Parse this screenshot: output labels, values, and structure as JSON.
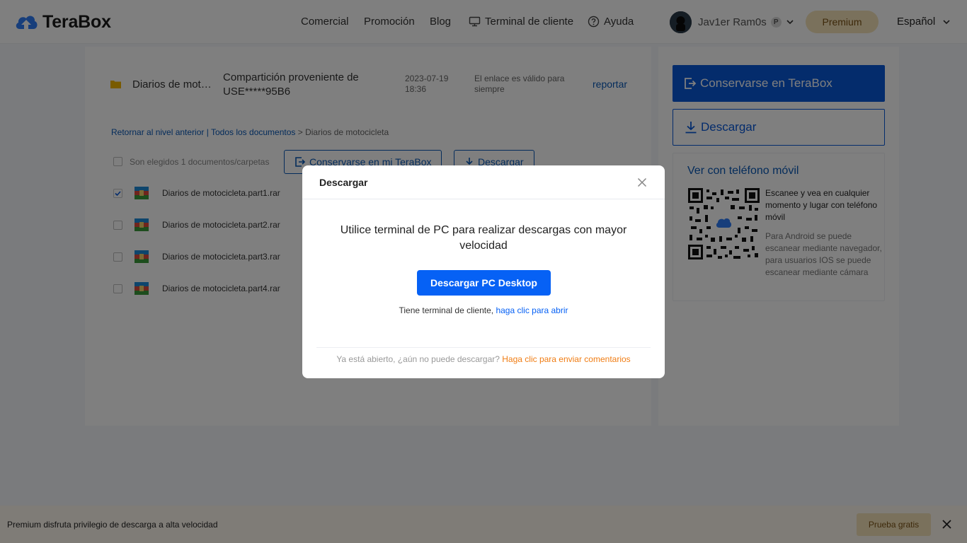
{
  "header": {
    "logo_text": "TeraBox",
    "nav": [
      {
        "label": "Comercial"
      },
      {
        "label": "Promoción"
      },
      {
        "label": "Blog"
      },
      {
        "label": "Terminal de cliente",
        "icon": "monitor-icon"
      },
      {
        "label": "Ayuda",
        "icon": "help-icon"
      }
    ],
    "username": "Jav1er Ram0s",
    "badge": "P",
    "premium_label": "Premium",
    "language": "Español"
  },
  "share": {
    "folder_name": "Diarios de moto...",
    "from_text": "Compartición proveniente de USE*****95B6",
    "date_line1": "2023-07-19",
    "date_line2": "18:36",
    "validity": "El enlace es válido para siempre",
    "report_label": "reportar"
  },
  "breadcrumb": {
    "back": "Retornar al nivel anterior",
    "sep": " | ",
    "all": "Todos los documentos",
    "arrow": " > ",
    "current": "Diarios de motocicleta"
  },
  "toolbar": {
    "selected_text": "Son elegidos 1 documentos/carpetas",
    "keep_label": "Conservarse en mi TeraBox",
    "download_label": "Descargar"
  },
  "files": [
    {
      "name": "Diarios de motocicleta.part1.rar",
      "checked": true
    },
    {
      "name": "Diarios de motocicleta.part2.rar",
      "checked": false
    },
    {
      "name": "Diarios de motocicleta.part3.rar",
      "checked": false
    },
    {
      "name": "Diarios de motocicleta.part4.rar",
      "checked": false
    }
  ],
  "side": {
    "keep_label": "Conservarse en TeraBox",
    "download_label": "Descargar",
    "mobile_title": "Ver con teléfono móvil",
    "qr_text": "Escanee y vea en cualquier momento y lugar con teléfono móvil",
    "qr_note": "Para Android se puede escanear mediante navegador, para usuarios IOS se puede escanear mediante cámara"
  },
  "banner": {
    "text": "Premium disfruta privilegio de descarga a alta velocidad",
    "trial_label": "Prueba gratis"
  },
  "modal": {
    "title": "Descargar",
    "message": "Utilice terminal de PC para realizar descargas con mayor velocidad",
    "primary_label": "Descargar PC Desktop",
    "open_prefix": "Tiene terminal de cliente, ",
    "open_link": "haga clic para abrir",
    "foot_prefix": "Ya está abierto, ¿aún no puede descargar? ",
    "foot_link": "Haga clic para enviar comentarios"
  },
  "colors": {
    "brand_blue": "#0958d9",
    "primary_button": "#0661f5",
    "link_orange": "#f07d14",
    "premium_gold": "#f5e2b8"
  }
}
